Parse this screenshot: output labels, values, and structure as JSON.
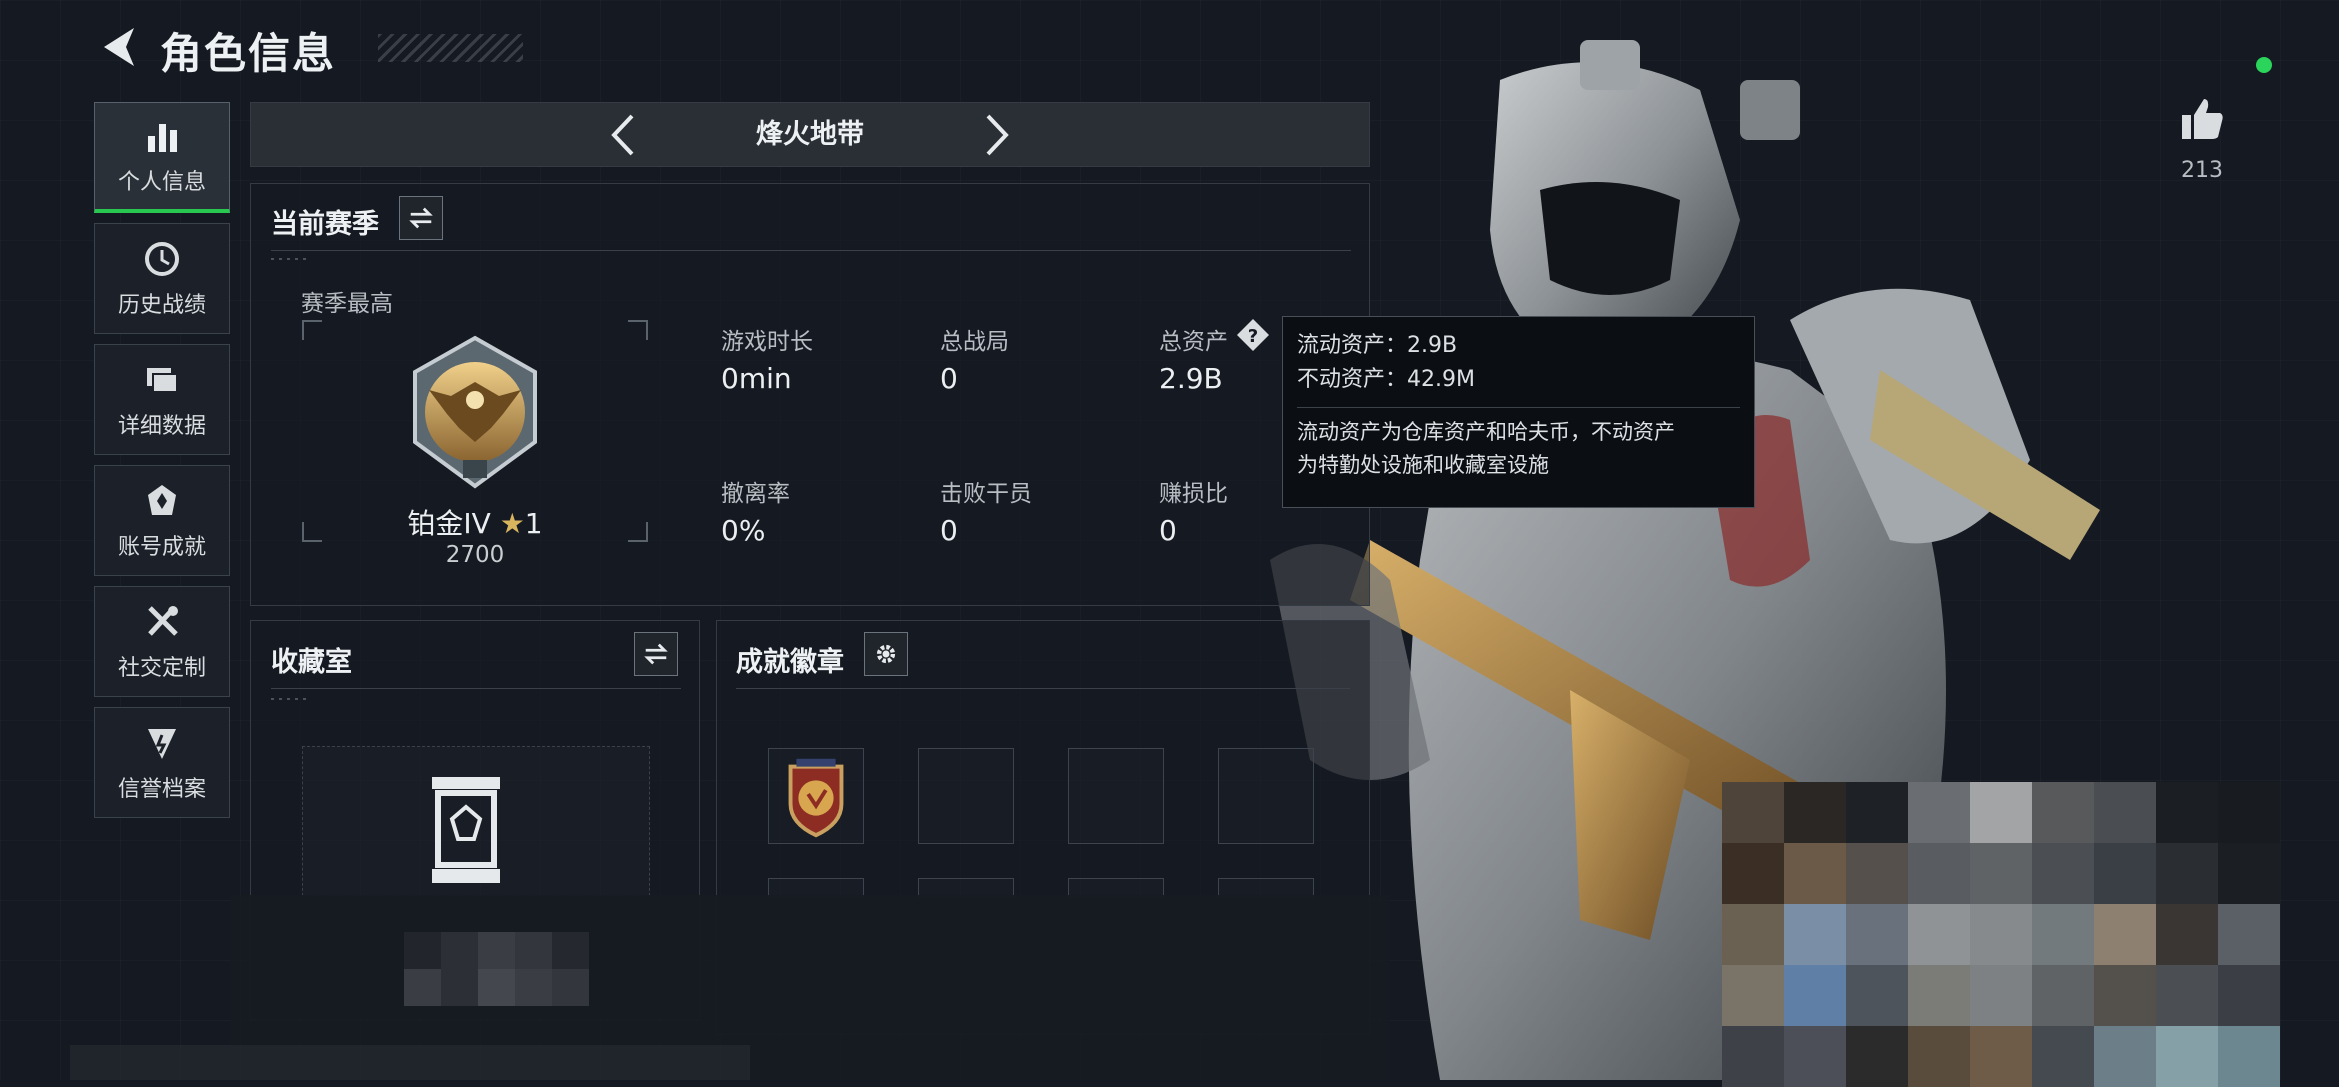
{
  "header": {
    "title": "角色信息"
  },
  "sidebar": {
    "items": [
      {
        "label": "个人信息",
        "icon": "bar-chart-icon",
        "active": true
      },
      {
        "label": "历史战绩",
        "icon": "clock-icon"
      },
      {
        "label": "详细数据",
        "icon": "folder-icon"
      },
      {
        "label": "账号成就",
        "icon": "achievement-icon"
      },
      {
        "label": "社交定制",
        "icon": "tools-icon"
      },
      {
        "label": "信誉档案",
        "icon": "shield-icon"
      }
    ]
  },
  "mode_selector": {
    "title": "烽火地带"
  },
  "season": {
    "title": "当前赛季",
    "highest_label": "赛季最高",
    "rank_name": "铂金IV",
    "rank_stars": "1",
    "rank_score": "2700",
    "stats": [
      {
        "label": "游戏时长",
        "value": "0min"
      },
      {
        "label": "总战局",
        "value": "0"
      },
      {
        "label": "总资产",
        "value": "2.9B"
      },
      {
        "label": "撤离率",
        "value": "0%"
      },
      {
        "label": "击败干员",
        "value": "0"
      },
      {
        "label": "赚损比",
        "value": "0"
      }
    ]
  },
  "collection": {
    "title": "收藏室"
  },
  "badges": {
    "title": "成就徽章"
  },
  "tooltip": {
    "liquid": "流动资产：2.9B",
    "fixed": "不动资产：42.9M",
    "description_line1": "流动资产为仓库资产和哈夫币，不动资产",
    "description_line2": "为特勤处设施和收藏室设施"
  },
  "likes": {
    "count": "213"
  },
  "colors": {
    "accent_green": "#28c850",
    "panel_bg": "#1b2029",
    "rank_gold": "#c99a45"
  }
}
